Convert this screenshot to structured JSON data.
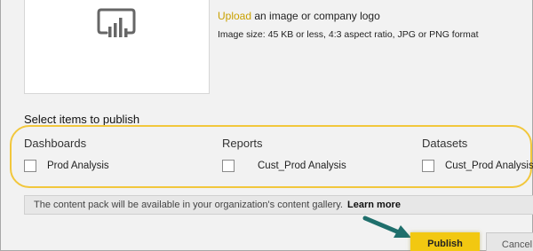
{
  "logo": {
    "icon": "power-bi-report-icon",
    "upload_link": "Upload",
    "upload_text": " an image or company logo",
    "size_info": "Image size: 45 KB or less, 4:3 aspect ratio, JPG or PNG format"
  },
  "select_section": {
    "title": "Select items to publish",
    "columns": [
      {
        "heading": "Dashboards",
        "items": [
          {
            "label": "Prod Analysis",
            "checked": false
          }
        ]
      },
      {
        "heading": "Reports",
        "items": [
          {
            "label": "Cust_Prod Analysis",
            "checked": false
          }
        ]
      },
      {
        "heading": "Datasets",
        "items": [
          {
            "label": "Cust_Prod Analysis",
            "checked": false
          }
        ]
      }
    ]
  },
  "info": {
    "message": "The content pack will be available in your organization's content gallery.",
    "link": "Learn more"
  },
  "buttons": {
    "publish": "Publish",
    "cancel": "Cancel"
  },
  "colors": {
    "accent": "#f2c811",
    "highlight": "#f2c73c",
    "arrow": "#1f6f6c",
    "upload_link": "#c9a000"
  }
}
